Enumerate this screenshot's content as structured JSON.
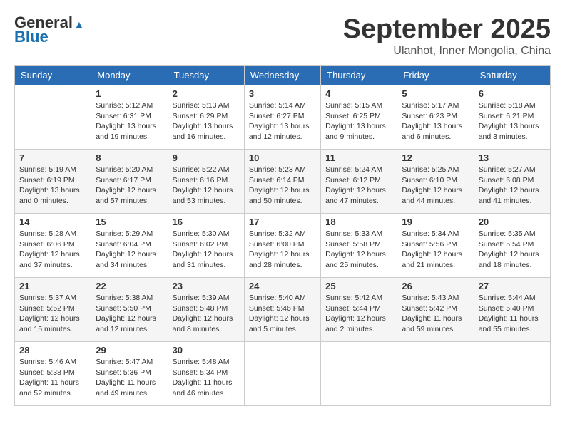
{
  "app": {
    "logo_line1": "General",
    "logo_line2": "Blue"
  },
  "header": {
    "month": "September 2025",
    "location": "Ulanhot, Inner Mongolia, China"
  },
  "days_of_week": [
    "Sunday",
    "Monday",
    "Tuesday",
    "Wednesday",
    "Thursday",
    "Friday",
    "Saturday"
  ],
  "weeks": [
    [
      {
        "day": "",
        "info": ""
      },
      {
        "day": "1",
        "info": "Sunrise: 5:12 AM\nSunset: 6:31 PM\nDaylight: 13 hours\nand 19 minutes."
      },
      {
        "day": "2",
        "info": "Sunrise: 5:13 AM\nSunset: 6:29 PM\nDaylight: 13 hours\nand 16 minutes."
      },
      {
        "day": "3",
        "info": "Sunrise: 5:14 AM\nSunset: 6:27 PM\nDaylight: 13 hours\nand 12 minutes."
      },
      {
        "day": "4",
        "info": "Sunrise: 5:15 AM\nSunset: 6:25 PM\nDaylight: 13 hours\nand 9 minutes."
      },
      {
        "day": "5",
        "info": "Sunrise: 5:17 AM\nSunset: 6:23 PM\nDaylight: 13 hours\nand 6 minutes."
      },
      {
        "day": "6",
        "info": "Sunrise: 5:18 AM\nSunset: 6:21 PM\nDaylight: 13 hours\nand 3 minutes."
      }
    ],
    [
      {
        "day": "7",
        "info": "Sunrise: 5:19 AM\nSunset: 6:19 PM\nDaylight: 13 hours\nand 0 minutes."
      },
      {
        "day": "8",
        "info": "Sunrise: 5:20 AM\nSunset: 6:17 PM\nDaylight: 12 hours\nand 57 minutes."
      },
      {
        "day": "9",
        "info": "Sunrise: 5:22 AM\nSunset: 6:16 PM\nDaylight: 12 hours\nand 53 minutes."
      },
      {
        "day": "10",
        "info": "Sunrise: 5:23 AM\nSunset: 6:14 PM\nDaylight: 12 hours\nand 50 minutes."
      },
      {
        "day": "11",
        "info": "Sunrise: 5:24 AM\nSunset: 6:12 PM\nDaylight: 12 hours\nand 47 minutes."
      },
      {
        "day": "12",
        "info": "Sunrise: 5:25 AM\nSunset: 6:10 PM\nDaylight: 12 hours\nand 44 minutes."
      },
      {
        "day": "13",
        "info": "Sunrise: 5:27 AM\nSunset: 6:08 PM\nDaylight: 12 hours\nand 41 minutes."
      }
    ],
    [
      {
        "day": "14",
        "info": "Sunrise: 5:28 AM\nSunset: 6:06 PM\nDaylight: 12 hours\nand 37 minutes."
      },
      {
        "day": "15",
        "info": "Sunrise: 5:29 AM\nSunset: 6:04 PM\nDaylight: 12 hours\nand 34 minutes."
      },
      {
        "day": "16",
        "info": "Sunrise: 5:30 AM\nSunset: 6:02 PM\nDaylight: 12 hours\nand 31 minutes."
      },
      {
        "day": "17",
        "info": "Sunrise: 5:32 AM\nSunset: 6:00 PM\nDaylight: 12 hours\nand 28 minutes."
      },
      {
        "day": "18",
        "info": "Sunrise: 5:33 AM\nSunset: 5:58 PM\nDaylight: 12 hours\nand 25 minutes."
      },
      {
        "day": "19",
        "info": "Sunrise: 5:34 AM\nSunset: 5:56 PM\nDaylight: 12 hours\nand 21 minutes."
      },
      {
        "day": "20",
        "info": "Sunrise: 5:35 AM\nSunset: 5:54 PM\nDaylight: 12 hours\nand 18 minutes."
      }
    ],
    [
      {
        "day": "21",
        "info": "Sunrise: 5:37 AM\nSunset: 5:52 PM\nDaylight: 12 hours\nand 15 minutes."
      },
      {
        "day": "22",
        "info": "Sunrise: 5:38 AM\nSunset: 5:50 PM\nDaylight: 12 hours\nand 12 minutes."
      },
      {
        "day": "23",
        "info": "Sunrise: 5:39 AM\nSunset: 5:48 PM\nDaylight: 12 hours\nand 8 minutes."
      },
      {
        "day": "24",
        "info": "Sunrise: 5:40 AM\nSunset: 5:46 PM\nDaylight: 12 hours\nand 5 minutes."
      },
      {
        "day": "25",
        "info": "Sunrise: 5:42 AM\nSunset: 5:44 PM\nDaylight: 12 hours\nand 2 minutes."
      },
      {
        "day": "26",
        "info": "Sunrise: 5:43 AM\nSunset: 5:42 PM\nDaylight: 11 hours\nand 59 minutes."
      },
      {
        "day": "27",
        "info": "Sunrise: 5:44 AM\nSunset: 5:40 PM\nDaylight: 11 hours\nand 55 minutes."
      }
    ],
    [
      {
        "day": "28",
        "info": "Sunrise: 5:46 AM\nSunset: 5:38 PM\nDaylight: 11 hours\nand 52 minutes."
      },
      {
        "day": "29",
        "info": "Sunrise: 5:47 AM\nSunset: 5:36 PM\nDaylight: 11 hours\nand 49 minutes."
      },
      {
        "day": "30",
        "info": "Sunrise: 5:48 AM\nSunset: 5:34 PM\nDaylight: 11 hours\nand 46 minutes."
      },
      {
        "day": "",
        "info": ""
      },
      {
        "day": "",
        "info": ""
      },
      {
        "day": "",
        "info": ""
      },
      {
        "day": "",
        "info": ""
      }
    ]
  ]
}
